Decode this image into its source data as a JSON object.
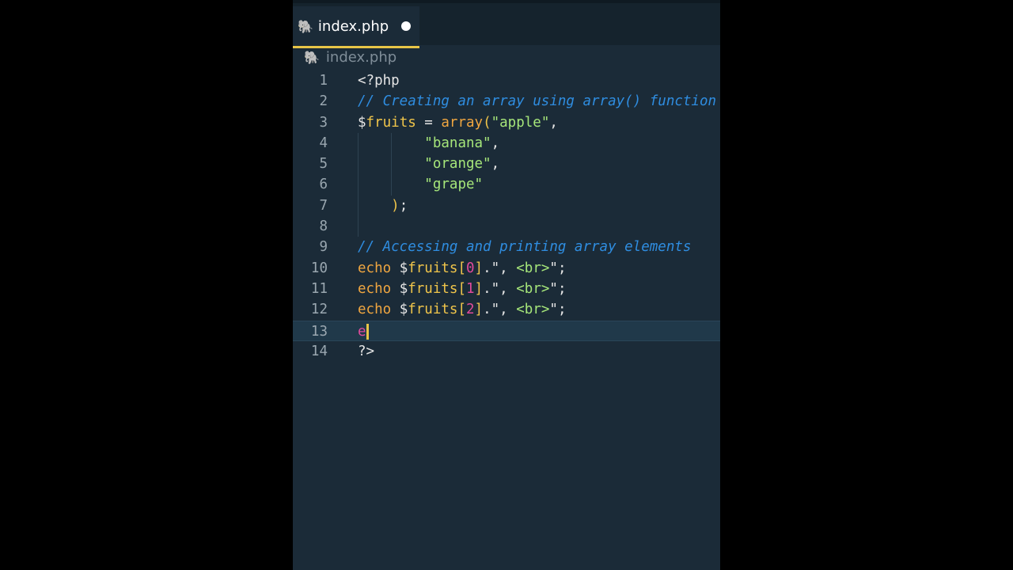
{
  "tab": {
    "label": "index.php",
    "icon": "php-elephant-icon",
    "modified": true
  },
  "breadcrumb": {
    "label": "index.php"
  },
  "current_line": 13,
  "lines": [
    {
      "n": "1",
      "tokens": [
        [
          "<?php",
          "d"
        ]
      ]
    },
    {
      "n": "2",
      "tokens": [
        [
          "// Creating an array using array() function",
          "c"
        ]
      ]
    },
    {
      "n": "3",
      "tokens": [
        [
          "$",
          "d"
        ],
        [
          "fruits",
          "v"
        ],
        [
          " = ",
          "d"
        ],
        [
          "array",
          "f"
        ],
        [
          "(",
          "p"
        ],
        [
          "\"apple\"",
          "s"
        ],
        [
          ",",
          "d"
        ]
      ]
    },
    {
      "n": "4",
      "tokens": [
        [
          "        ",
          "d"
        ],
        [
          "\"banana\"",
          "s"
        ],
        [
          ",",
          "d"
        ]
      ]
    },
    {
      "n": "5",
      "tokens": [
        [
          "        ",
          "d"
        ],
        [
          "\"orange\"",
          "s"
        ],
        [
          ",",
          "d"
        ]
      ]
    },
    {
      "n": "6",
      "tokens": [
        [
          "        ",
          "d"
        ],
        [
          "\"grape\"",
          "s"
        ]
      ]
    },
    {
      "n": "7",
      "tokens": [
        [
          "    ",
          "d"
        ],
        [
          ")",
          "p"
        ],
        [
          ";",
          "d"
        ]
      ]
    },
    {
      "n": "8",
      "tokens": []
    },
    {
      "n": "9",
      "tokens": [
        [
          "// Accessing and printing array elements",
          "c"
        ]
      ]
    },
    {
      "n": "10",
      "tokens": [
        [
          "echo",
          "k"
        ],
        [
          " $",
          "d"
        ],
        [
          "fruits",
          "v"
        ],
        [
          "[",
          "p"
        ],
        [
          "0",
          "n"
        ],
        [
          "]",
          "p"
        ],
        [
          ".\"",
          "d"
        ],
        [
          ", ",
          "d"
        ],
        [
          "<br>",
          "s"
        ],
        [
          "\";",
          "d"
        ]
      ]
    },
    {
      "n": "11",
      "tokens": [
        [
          "echo",
          "k"
        ],
        [
          " $",
          "d"
        ],
        [
          "fruits",
          "v"
        ],
        [
          "[",
          "p"
        ],
        [
          "1",
          "n"
        ],
        [
          "]",
          "p"
        ],
        [
          ".\"",
          "d"
        ],
        [
          ", ",
          "d"
        ],
        [
          "<br>",
          "s"
        ],
        [
          "\";",
          "d"
        ]
      ]
    },
    {
      "n": "12",
      "tokens": [
        [
          "echo",
          "k"
        ],
        [
          " $",
          "d"
        ],
        [
          "fruits",
          "v"
        ],
        [
          "[",
          "p"
        ],
        [
          "2",
          "n"
        ],
        [
          "]",
          "p"
        ],
        [
          ".\"",
          "d"
        ],
        [
          ", ",
          "d"
        ],
        [
          "<br>",
          "s"
        ],
        [
          "\";",
          "d"
        ]
      ]
    },
    {
      "n": "13",
      "tokens": [
        [
          "e",
          "e"
        ]
      ]
    },
    {
      "n": "14",
      "tokens": [
        [
          "?>",
          "d"
        ]
      ]
    }
  ]
}
